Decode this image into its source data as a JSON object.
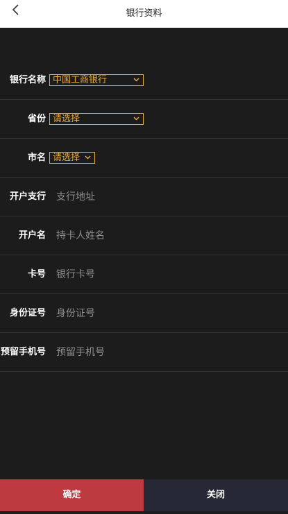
{
  "header": {
    "title": "银行资料",
    "back_icon": "chevron-left-icon"
  },
  "form": {
    "bank_name": {
      "label": "银行名称",
      "value": "中国工商银行"
    },
    "province": {
      "label": "省份",
      "value": "请选择"
    },
    "city": {
      "label": "市名",
      "value": "请选择"
    },
    "branch": {
      "label": "开户支行",
      "placeholder": "支行地址"
    },
    "account_name": {
      "label": "开户名",
      "placeholder": "持卡人姓名"
    },
    "card_number": {
      "label": "卡号",
      "placeholder": "银行卡号"
    },
    "id_number": {
      "label": "身份证号",
      "placeholder": "身份证号"
    },
    "phone": {
      "label": "预留手机号",
      "placeholder": "预留手机号"
    }
  },
  "footer": {
    "confirm_label": "确定",
    "close_label": "关闭"
  },
  "colors": {
    "background": "#1c1c1c",
    "accent": "#e9a93a",
    "confirm": "#bd3a40",
    "close": "#272835"
  }
}
